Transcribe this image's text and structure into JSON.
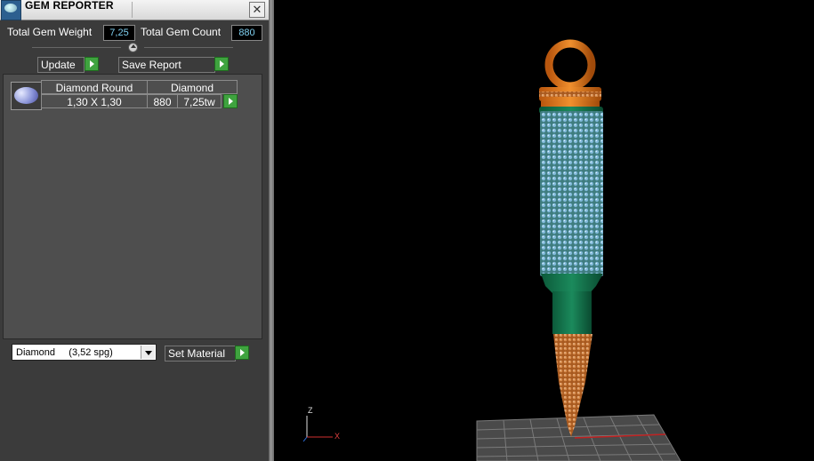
{
  "title": "GEM REPORTER",
  "stats": {
    "weight_label": "Total Gem Weight",
    "weight_value": "7,25",
    "count_label": "Total Gem Count",
    "count_value": "880"
  },
  "buttons": {
    "update": "Update",
    "save_report": "Save Report",
    "set_material": "Set Material"
  },
  "gem_row": {
    "shape_header": "Diamond Round",
    "material_header": "Diamond",
    "size": "1,30 X 1,30",
    "count": "880",
    "weight": "7,25tw"
  },
  "material_select": {
    "value": "Diamond     (3,52 spg)"
  },
  "axes": {
    "z": "Z",
    "x": "X"
  },
  "icons": [
    "app-icon",
    "close-icon",
    "collapse-icon",
    "arrow-right-icon",
    "gem-thumbnail",
    "chevron-down-icon"
  ],
  "colors": {
    "panel_bg": "#3b3b3b",
    "go_button": "#3fa33f",
    "value_text": "#7fd0f0",
    "viewport_bg": "#000000"
  }
}
